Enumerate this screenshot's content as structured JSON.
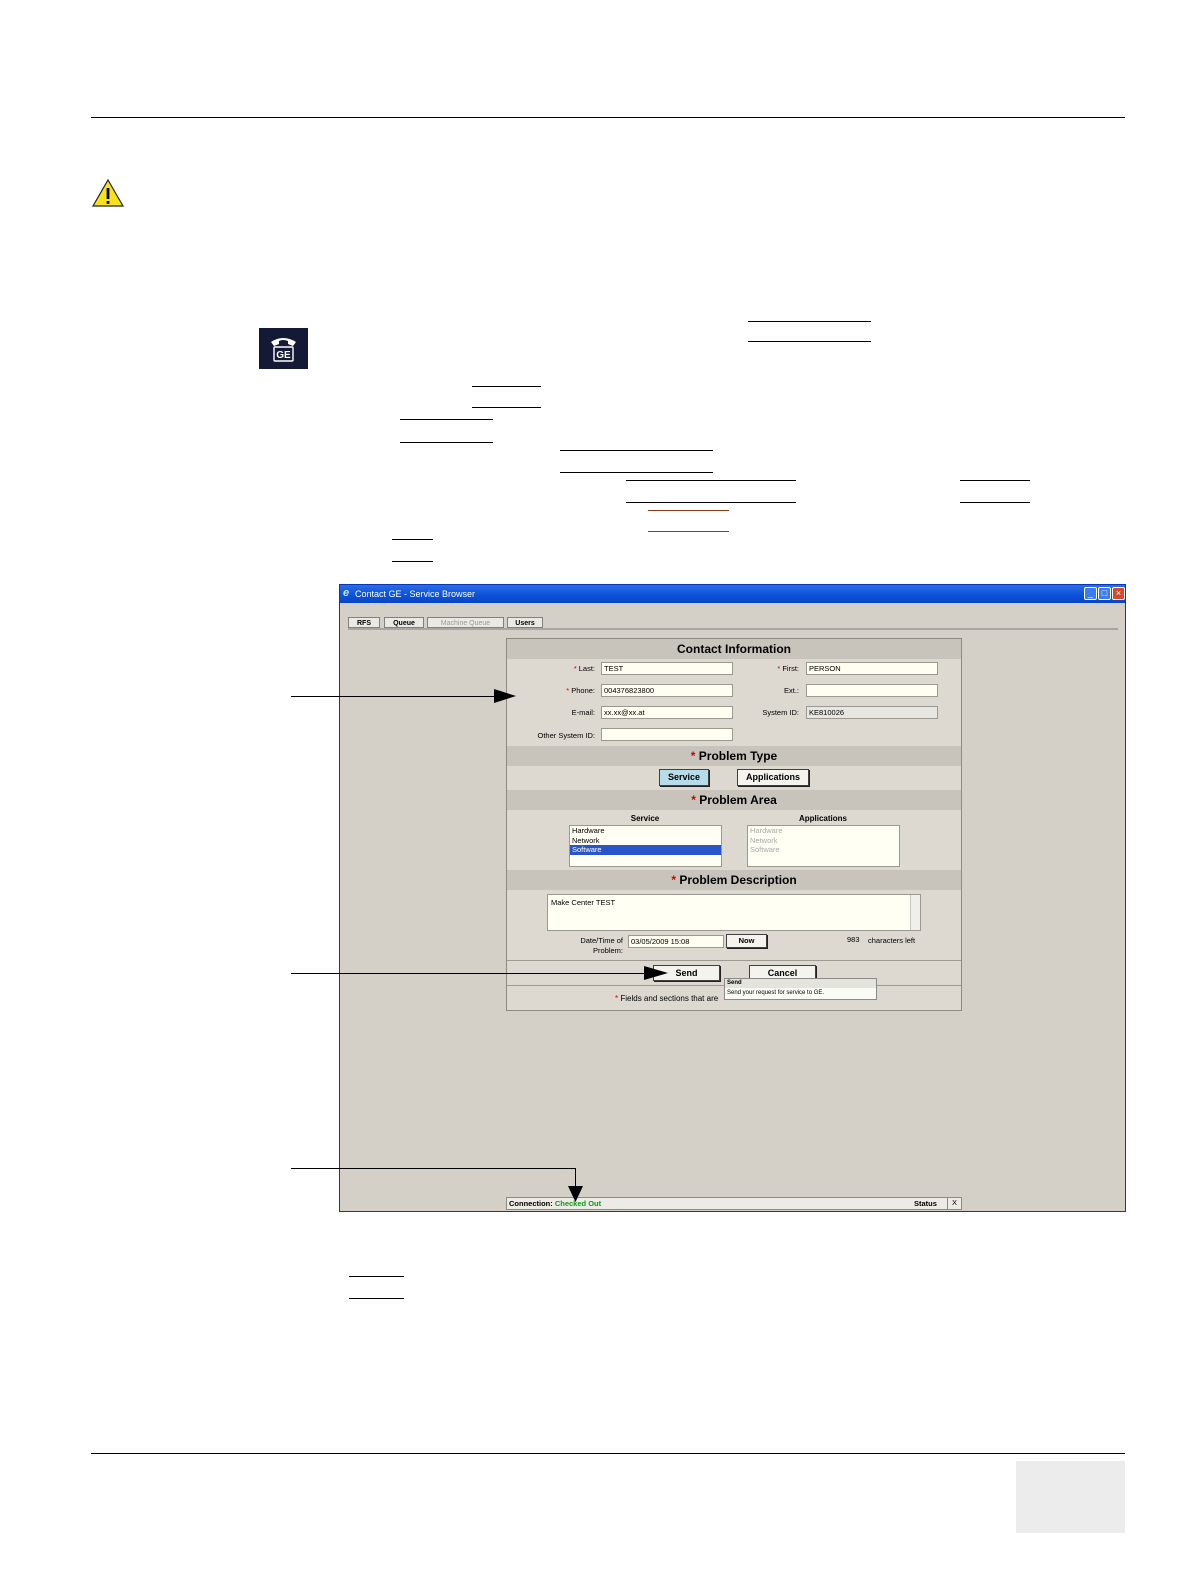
{
  "window": {
    "title": "Contact GE - Service Browser",
    "tabs": [
      "RFS",
      "Queue",
      "Machine Queue",
      "Users"
    ]
  },
  "contact": {
    "header": "Contact Information",
    "last_label": "Last:",
    "last_value": "TEST",
    "first_label": "First:",
    "first_value": "PERSON",
    "phone_label": "Phone:",
    "phone_value": "004376823800",
    "ext_label": "Ext.:",
    "ext_value": "",
    "email_label": "E-mail:",
    "email_value": "xx.xx@xx.at",
    "system_id_label": "System ID:",
    "system_id_value": "KE810026",
    "other_system_label": "Other System ID:",
    "other_system_value": ""
  },
  "problem_type": {
    "header": "Problem Type",
    "service_button": "Service",
    "applications_button": "Applications"
  },
  "problem_area": {
    "header": "Problem Area",
    "service_col": "Service",
    "applications_col": "Applications",
    "service_items": [
      "Hardware",
      "Network",
      "Software"
    ],
    "application_items": [
      "Hardware",
      "Network",
      "Software"
    ],
    "selected": "Software"
  },
  "problem_description": {
    "header": "Problem Description",
    "text": "Make Center TEST",
    "datetime_label_1": "Date/Time of",
    "datetime_label_2": "Problem:",
    "datetime_value": "03/05/2009 15:08",
    "now_button": "Now",
    "chars_left_count": "983",
    "chars_left_label": "characters left"
  },
  "actions": {
    "send": "Send",
    "cancel": "Cancel",
    "required_note": "Fields and sections that are",
    "tooltip_title": "Send",
    "tooltip_body": "Send your request for service to GE."
  },
  "status_bar": {
    "connection_label": "Connection:",
    "connection_value": "Checked Out",
    "status_label": "Status",
    "close": "X"
  },
  "required_mark": "*",
  "icons": {
    "warning": "warning-triangle-icon",
    "contact_ge": "contact-ge-phone-icon"
  },
  "colors": {
    "title_bar": "#0a50d8",
    "required": "#d00000",
    "connection_ok": "#0c9a16",
    "selection": "#2a55c8"
  }
}
